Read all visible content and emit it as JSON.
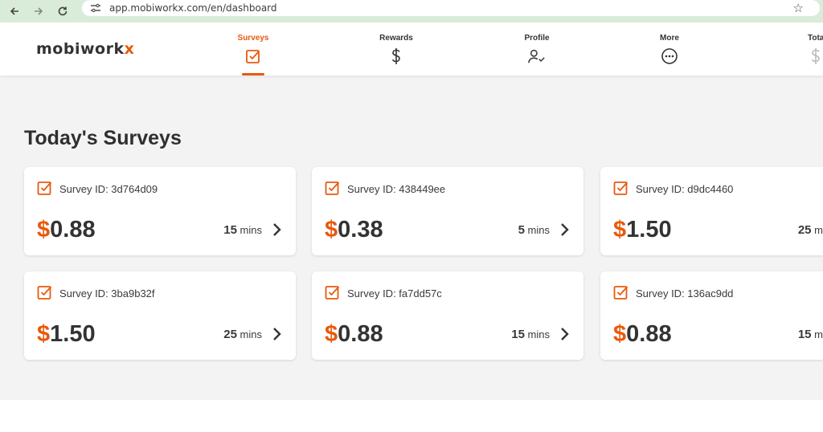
{
  "browser": {
    "url": "app.mobiworkx.com/en/dashboard"
  },
  "brand": {
    "name_main": "mobiwork",
    "name_accent": "x",
    "accent_color": "#e8590c"
  },
  "nav": {
    "items": [
      {
        "label": "Surveys",
        "icon": "survey-check-icon",
        "active": true
      },
      {
        "label": "Rewards",
        "icon": "dollar-icon"
      },
      {
        "label": "Profile",
        "icon": "profile-check-icon"
      },
      {
        "label": "More",
        "icon": "more-dots-icon"
      },
      {
        "label": "Tota",
        "icon": "dollar-icon"
      }
    ]
  },
  "page": {
    "title": "Today's Surveys"
  },
  "surveys": [
    {
      "id_label": "Survey ID: 3d764d09",
      "amount": "0.88",
      "minutes": "15",
      "unit": "mins"
    },
    {
      "id_label": "Survey ID: 438449ee",
      "amount": "0.38",
      "minutes": "5",
      "unit": "mins"
    },
    {
      "id_label": "Survey ID: d9dc4460",
      "amount": "1.50",
      "minutes": "25",
      "unit": "m"
    },
    {
      "id_label": "Survey ID: 3ba9b32f",
      "amount": "1.50",
      "minutes": "25",
      "unit": "mins"
    },
    {
      "id_label": "Survey ID: fa7dd57c",
      "amount": "0.88",
      "minutes": "15",
      "unit": "mins"
    },
    {
      "id_label": "Survey ID: 136ac9dd",
      "amount": "0.88",
      "minutes": "15",
      "unit": "m"
    }
  ],
  "currency_symbol": "$"
}
